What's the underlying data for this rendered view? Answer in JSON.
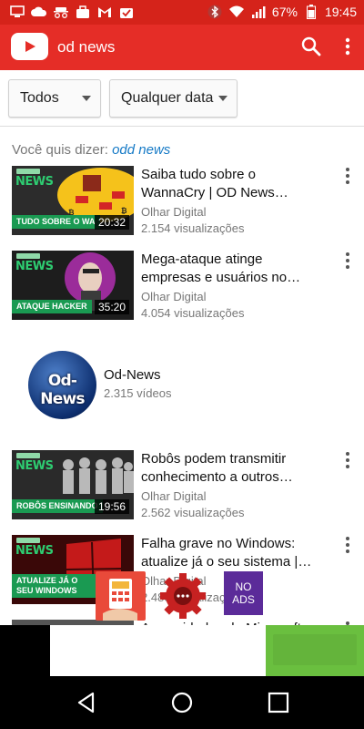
{
  "colors": {
    "brand_red": "#e52d27",
    "status_red": "#d5231a",
    "link_blue": "#167ac6"
  },
  "status_bar": {
    "battery": "67%",
    "time": "19:45",
    "left_icons": [
      "monitor-icon",
      "cloud-icon",
      "spy-icon",
      "briefcase-icon",
      "gmail-icon",
      "inbox-check-icon"
    ],
    "right_icons": [
      "bluetooth-icon",
      "wifi-icon",
      "signal-icon",
      "battery-icon"
    ]
  },
  "app_bar": {
    "query": "od news"
  },
  "filters": {
    "type": "Todos",
    "date": "Qualquer data"
  },
  "suggestion": {
    "prefix": "Você quis dizer:",
    "term": "odd news"
  },
  "videos": [
    {
      "title": "Saiba tudo sobre o WannaCry | OD News…",
      "channel": "Olhar Digital",
      "views": "2.154 visualizações",
      "duration": "20:32",
      "caption": "TUDO SOBRE O WA",
      "thumb_colors": [
        "#f5c21b",
        "#2c2c2c"
      ]
    },
    {
      "title": "Mega-ataque atinge empresas e usuários no…",
      "channel": "Olhar Digital",
      "views": "4.054 visualizações",
      "duration": "35:20",
      "caption": "ATAQUE HACKER",
      "thumb_colors": [
        "#9b2c9a",
        "#1d1d1d"
      ]
    },
    {
      "title": "Robôs podem transmitir conhecimento a outros…",
      "channel": "Olhar Digital",
      "views": "2.562 visualizações",
      "duration": "19:56",
      "caption": "ROBÔS ENSINANDO",
      "thumb_colors": [
        "#8a8a8a",
        "#2a2a2a"
      ]
    },
    {
      "title": "Falha grave no Windows: atualize já o seu sistema |…",
      "channel": "Olhar Digital",
      "views": "2.480 visualizações",
      "duration": "",
      "caption": "ATUALIZE JÁ O SEU WINDOWS",
      "thumb_colors": [
        "#c41a1a",
        "#3a0808"
      ]
    },
    {
      "title": "As novidades da Microsoft",
      "channel": "",
      "views": "",
      "duration": "",
      "caption": "",
      "thumb_colors": [
        "#555555",
        "#222222"
      ]
    }
  ],
  "channel": {
    "avatar_text": "Od-News",
    "name": "Od-News",
    "count": "2.315 vídeos"
  },
  "floating": {
    "noads_label_1": "NO",
    "noads_label_2": "ADS"
  }
}
